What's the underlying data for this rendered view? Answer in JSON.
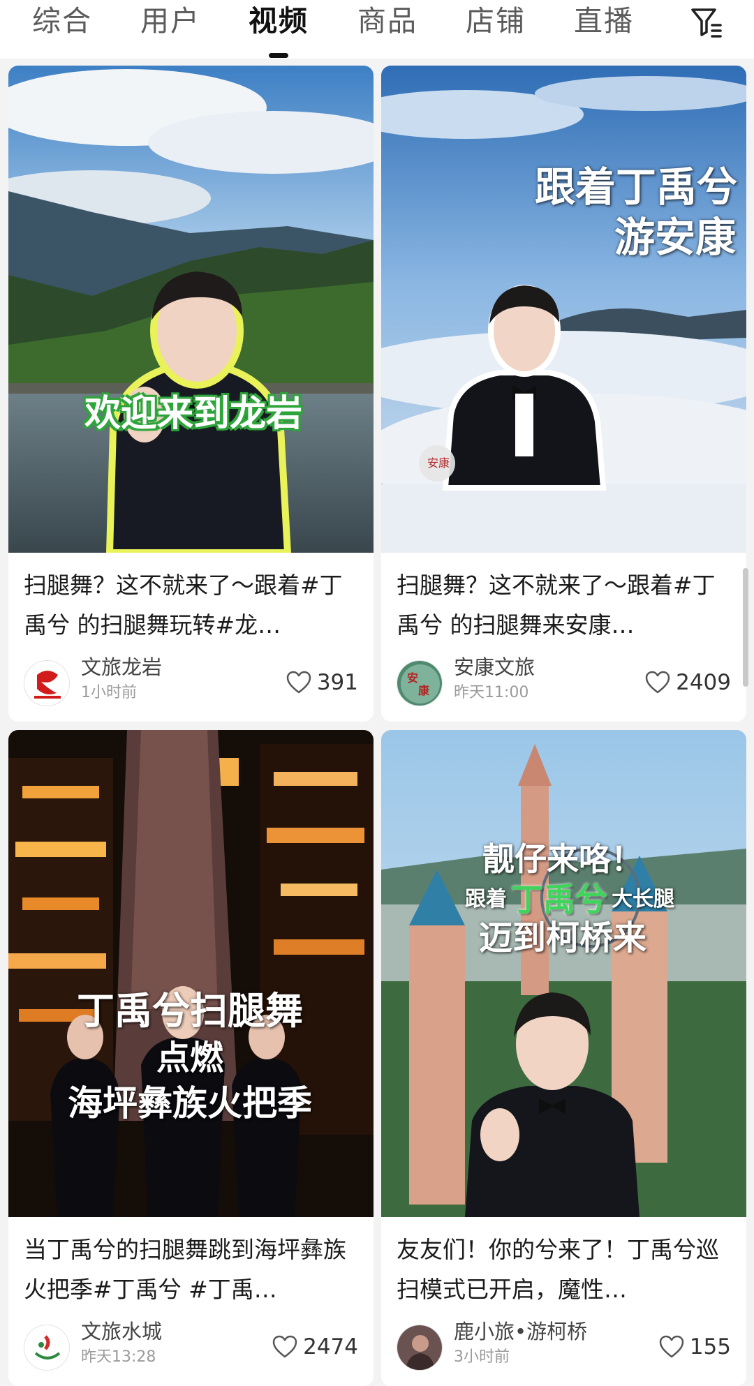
{
  "tabs": [
    {
      "label": "综合"
    },
    {
      "label": "用户"
    },
    {
      "label": "视频"
    },
    {
      "label": "商品"
    },
    {
      "label": "店铺"
    },
    {
      "label": "直播"
    }
  ],
  "active_tab": "视频",
  "filter_icon": "filter-icon",
  "cards": [
    {
      "overlay": "欢迎来到龙岩",
      "title": "扫腿舞？这不就来了～跟着#丁禹兮 的扫腿舞玩转#龙…",
      "author": "文旅龙岩",
      "time": "1小时前",
      "likes": "391"
    },
    {
      "overlay_line1": "跟着丁禹兮",
      "overlay_line2": "游安康",
      "title": "扫腿舞？这不就来了～跟着#丁禹兮 的扫腿舞来安康…",
      "author": "安康文旅",
      "time": "昨天11:00",
      "likes": "2409"
    },
    {
      "overlay_line1": "丁禹兮扫腿舞",
      "overlay_line2": "点燃",
      "overlay_line3": "海坪彝族火把季",
      "title": "当丁禹兮的扫腿舞跳到海坪彝族火把季#丁禹兮 #丁禹…",
      "author": "文旅水城",
      "time": "昨天13:28",
      "likes": "2474"
    },
    {
      "overlay_line1": "靓仔来咯！",
      "overlay_line2a": "跟着",
      "overlay_line2b": "丁禹兮",
      "overlay_line2c": "大长腿",
      "overlay_line3": "迈到柯桥来",
      "title": "友友们！你的兮来了！丁禹兮巡扫模式已开启，魔性…",
      "author": "鹿小旅•游柯桥",
      "time": "3小时前",
      "likes": "155"
    }
  ],
  "colors": {
    "active_tab": "#111111",
    "inactive_tab": "#5b5b5b",
    "background": "#f3f3f3",
    "card": "#ffffff",
    "overlay_green": "#3fd45a"
  }
}
